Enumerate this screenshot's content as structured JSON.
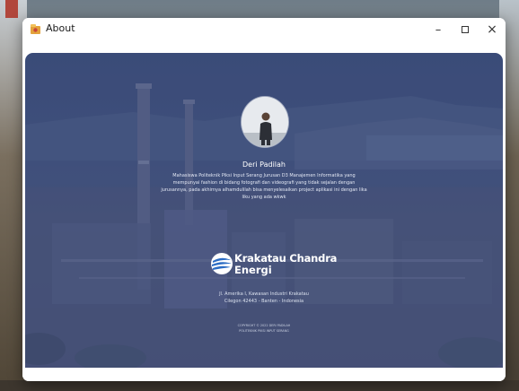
{
  "window": {
    "title": "About",
    "controls": {
      "minimize": "–",
      "close": "×"
    }
  },
  "profile": {
    "name": "Deri Padilah",
    "bio": "Mahasiswa Politeknik Piksi Input Serang Jurusan D3 Manajemen Informatika yang mempunyai fashion di bidang fotografi dan videografi yang tidak sejalan dengan jurusannya, pada akhirnya alhamdulilah bisa menyelesaikan project aplikasi ini dengan lika liku yang ada wkwk"
  },
  "company": {
    "name_line1": "Krakatau Chandra",
    "name_line2": "Energi",
    "address_line1": "Jl. Amerika I, Kawasan Industri Krakatau",
    "address_line2": "Cilegon 42443 - Banten - Indonesia"
  },
  "footer": {
    "copyright_line1": "COPYRIGHT © 2022 DERI PADILAH",
    "copyright_line2": "POLITEKNIK PIKSI INPUT SERANG"
  },
  "colors": {
    "panel": "#3d4f7a",
    "text": "#ffffff",
    "logo_blue": "#2b6cc4"
  },
  "icons": {
    "app": "app-icon",
    "logo": "krakatau-swoosh-logo"
  }
}
